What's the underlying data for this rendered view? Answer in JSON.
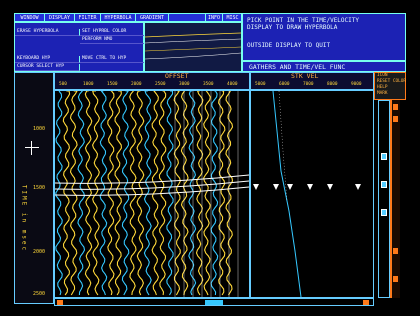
{
  "menu": {
    "items": [
      "WINDOW",
      "DISPLAY",
      "FILTER",
      "HYPERBOLA",
      "GRADIENT",
      "INFO",
      "MISC"
    ]
  },
  "buttons": {
    "erase_hyperbola": "ERASE HYPERBOLA",
    "set_hyperbola_color": "SET HYPRBL COLOR",
    "perform_nmo": "PERFORM NMO",
    "keyboard_hyp": "KEYBOARD HYP",
    "move_ctrl_to_hyp": "MOVE CTRL TO HYP",
    "cursor_select_hyp": "CURSOR SELECT HYP"
  },
  "message": {
    "line1": "PICK POINT IN THE TIME/VELOCITY",
    "line2": "DISPLAY TO DRAW HYPERBOLA",
    "line3": "OUTSIDE DISPLAY TO QUIT"
  },
  "panel_title": "GATHERS AND TIME/VEL FUNC",
  "offset_panel": {
    "label": "OFFSET",
    "ticks": [
      "500",
      "1000",
      "1500",
      "2000",
      "2500",
      "3000",
      "3500",
      "4000"
    ]
  },
  "velocity_panel": {
    "label": "STK VEL",
    "ticks": [
      "5000",
      "6000",
      "7000",
      "8000",
      "9000"
    ]
  },
  "time_axis": {
    "label": "TIME in msec",
    "ticks": [
      "1000",
      "1500",
      "2000",
      "2500"
    ]
  },
  "side_menu": [
    "ICON",
    "RESET COLOR",
    "HELP",
    "MARK"
  ],
  "colors": {
    "menu_blue": "#2430d8",
    "wiggle_yellow": "#ffd83a",
    "wiggle_cyan": "#35c8ff",
    "accent_orange": "#ff7a1a"
  }
}
